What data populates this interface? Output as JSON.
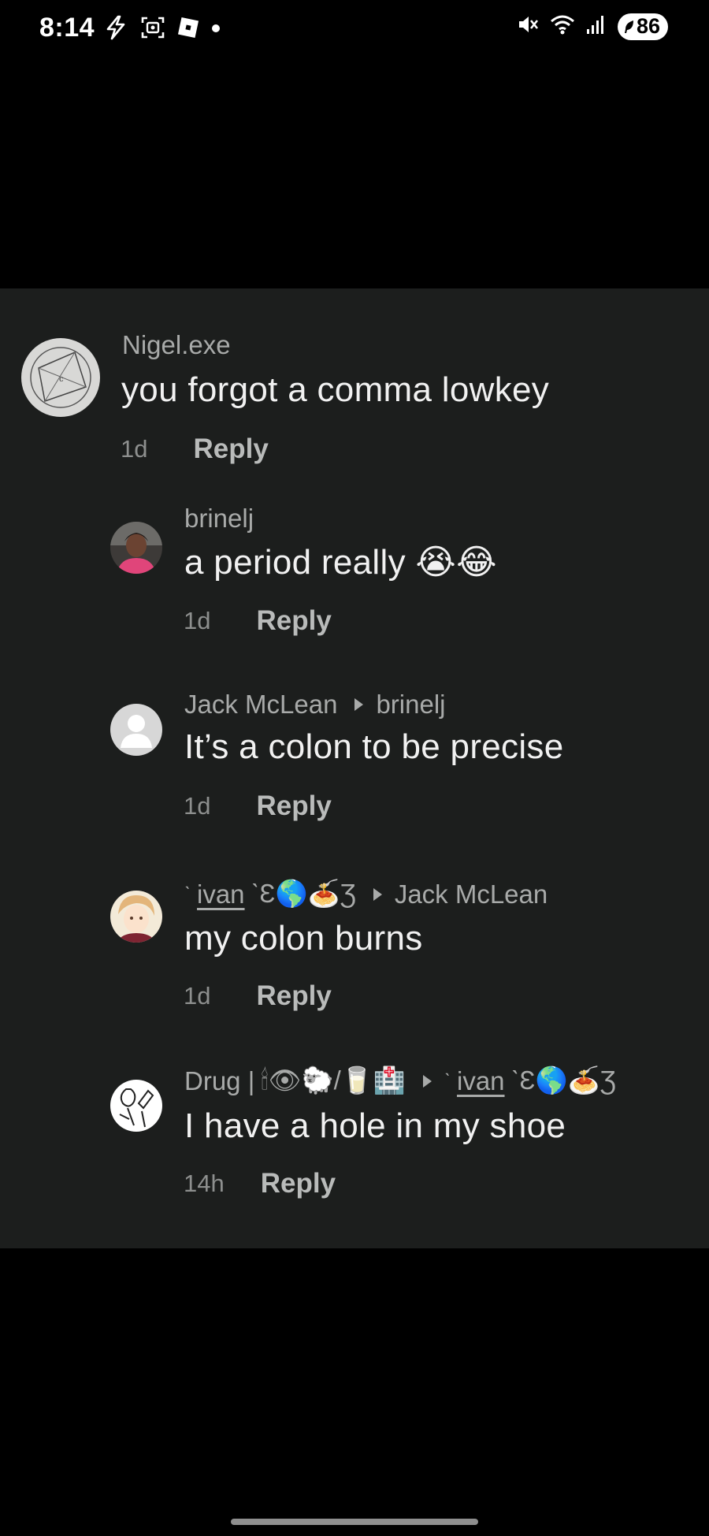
{
  "status_bar": {
    "time": "8:14",
    "battery": "86",
    "icons": [
      "bolt-icon",
      "screen-record-icon",
      "app-icon",
      "dot-icon",
      "mute-icon",
      "wifi-icon",
      "signal-icon",
      "battery-icon"
    ]
  },
  "comments": [
    {
      "username": "Nigel.exe",
      "reply_to": "",
      "text": "you forgot a comma lowkey",
      "time": "1d",
      "reply_label": "Reply"
    },
    {
      "username": "brinelj",
      "reply_to": "",
      "text": "a period really 😭😂",
      "time": "1d",
      "reply_label": "Reply"
    },
    {
      "username": "Jack McLean",
      "reply_to": "brinelj",
      "text": "It’s a colon to be precise",
      "time": "1d",
      "reply_label": "Reply"
    },
    {
      "username": "ivan",
      "username_suffix": "ˋƐ🌎🍝Ʒ",
      "reply_to": "Jack McLean",
      "text": "my colon burns",
      "time": "1d",
      "reply_label": "Reply"
    },
    {
      "username": "Drug |",
      "username_suffix": "🕯👁🐑/🥛🏥",
      "reply_to": "ivan",
      "reply_to_suffix": "ˋƐ🌎🍝Ʒ",
      "text": "I have a hole in my shoe",
      "time": "14h",
      "reply_label": "Reply"
    }
  ],
  "colors": {
    "panel_bg": "#1c1e1d",
    "username": "#a8aaa9",
    "comment_text": "#f1f1f1",
    "reply": "#b9bbba"
  }
}
